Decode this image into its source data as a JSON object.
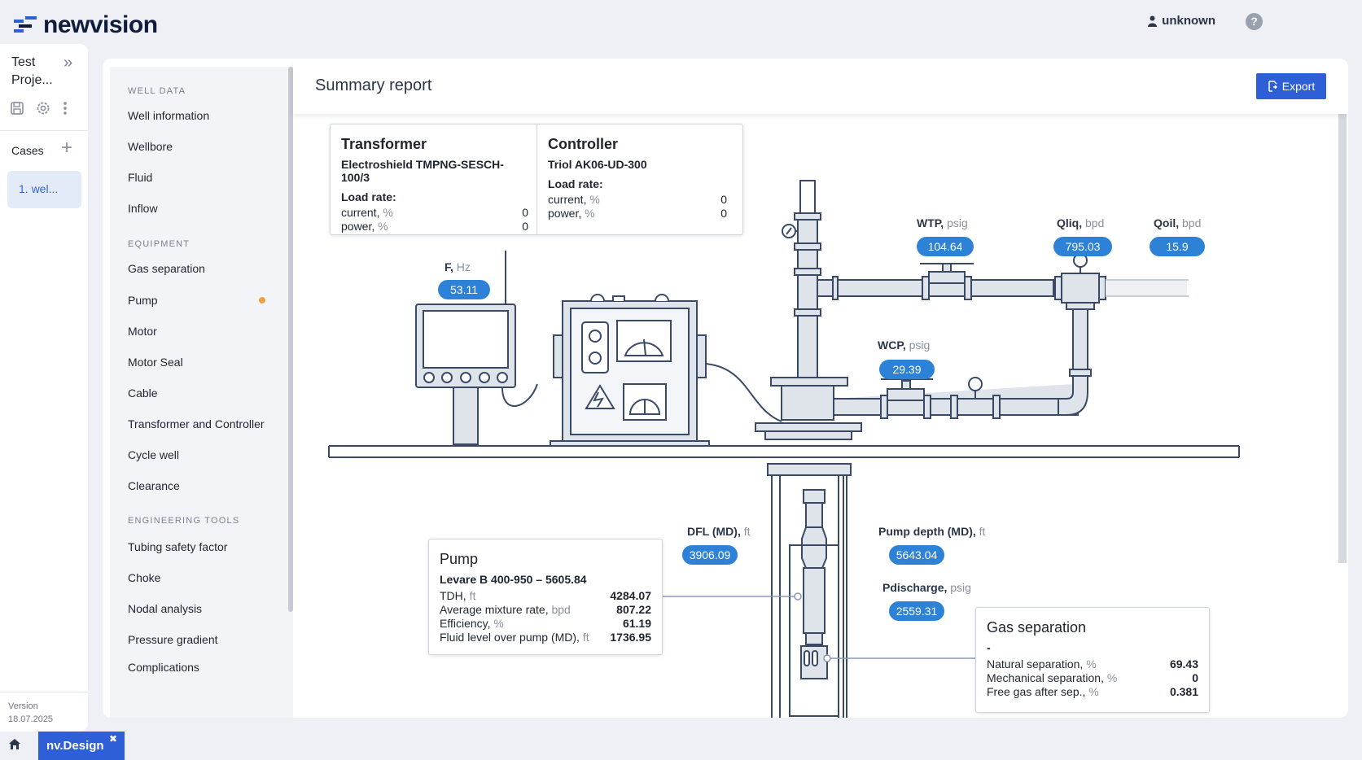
{
  "brand": {
    "name": "newvision"
  },
  "header": {
    "user": "unknown",
    "help_icon": "question-circle-icon",
    "user_icon": "user-icon"
  },
  "project": {
    "title": "Test Proje...",
    "cases_label": "Cases",
    "cases": [
      {
        "label": "1. wel..."
      }
    ],
    "version_label": "Version",
    "version_date": "18.07.2025"
  },
  "nav": {
    "sections": [
      {
        "title": "WELL DATA",
        "items": [
          "Well information",
          "Wellbore",
          "Fluid",
          "Inflow"
        ]
      },
      {
        "title": "EQUIPMENT",
        "items": [
          "Gas separation",
          "Pump",
          "Motor",
          "Motor Seal",
          "Cable",
          "Transformer and Controller",
          "Cycle well",
          "Clearance"
        ]
      },
      {
        "title": "ENGINEERING TOOLS",
        "items": [
          "Tubing safety factor",
          "Choke",
          "Nodal analysis",
          "Pressure gradient",
          "Complications"
        ]
      }
    ],
    "status_color": "#f0a040"
  },
  "page": {
    "title": "Summary report",
    "export_label": "Export"
  },
  "transformer": {
    "title": "Transformer",
    "model": "Electroshield TMPNG-SESCH-100/3",
    "load_rate": "Load rate:",
    "current_label": "current,",
    "current_unit": "%",
    "current_value": "0",
    "power_label": "power,",
    "power_unit": "%",
    "power_value": "0"
  },
  "controller": {
    "title": "Controller",
    "model": "Triol AK06-UD-300",
    "load_rate": "Load rate:",
    "current_label": "current,",
    "current_unit": "%",
    "current_value": "0",
    "power_label": "power,",
    "power_unit": "%",
    "power_value": "0"
  },
  "readings": {
    "freq": {
      "label": "F,",
      "unit": "Hz",
      "value": "53.11"
    },
    "wtp": {
      "label": "WTP,",
      "unit": "psig",
      "value": "104.64"
    },
    "qliq": {
      "label": "Qliq,",
      "unit": "bpd",
      "value": "795.03"
    },
    "qoil": {
      "label": "Qoil,",
      "unit": "bpd",
      "value": "15.9"
    },
    "wcp": {
      "label": "WCP,",
      "unit": "psig",
      "value": "29.39"
    },
    "dfl": {
      "label": "DFL (MD),",
      "unit": "ft",
      "value": "3906.09"
    },
    "pump_depth": {
      "label": "Pump depth (MD),",
      "unit": "ft",
      "value": "5643.04"
    },
    "pdischarge": {
      "label": "Pdischarge,",
      "unit": "psig",
      "value": "2559.31"
    }
  },
  "pump_card": {
    "title": "Pump",
    "model": "Levare B 400-950 – 5605.84",
    "rows": [
      {
        "label": "TDH,",
        "unit": "ft",
        "value": "4284.07"
      },
      {
        "label": "Average mixture rate,",
        "unit": "bpd",
        "value": "807.22"
      },
      {
        "label": "Efficiency,",
        "unit": "%",
        "value": "61.19"
      },
      {
        "label": "Fluid level over pump (MD),",
        "unit": "ft",
        "value": "1736.95"
      }
    ]
  },
  "gas_card": {
    "title": "Gas separation",
    "model": "-",
    "rows": [
      {
        "label": "Natural separation,",
        "unit": "%",
        "value": "69.43"
      },
      {
        "label": "Mechanical separation,",
        "unit": "%",
        "value": "0"
      },
      {
        "label": "Free gas after sep.,",
        "unit": "%",
        "value": "0.381"
      }
    ]
  },
  "taskbar": {
    "app": "nv.Design",
    "close": "✖",
    "home_icon": "home-icon"
  },
  "colors": {
    "accent": "#2f5fd6",
    "chip": "#2d82d8",
    "line": "#3a4a66",
    "pipe": "#dfe3ea"
  }
}
